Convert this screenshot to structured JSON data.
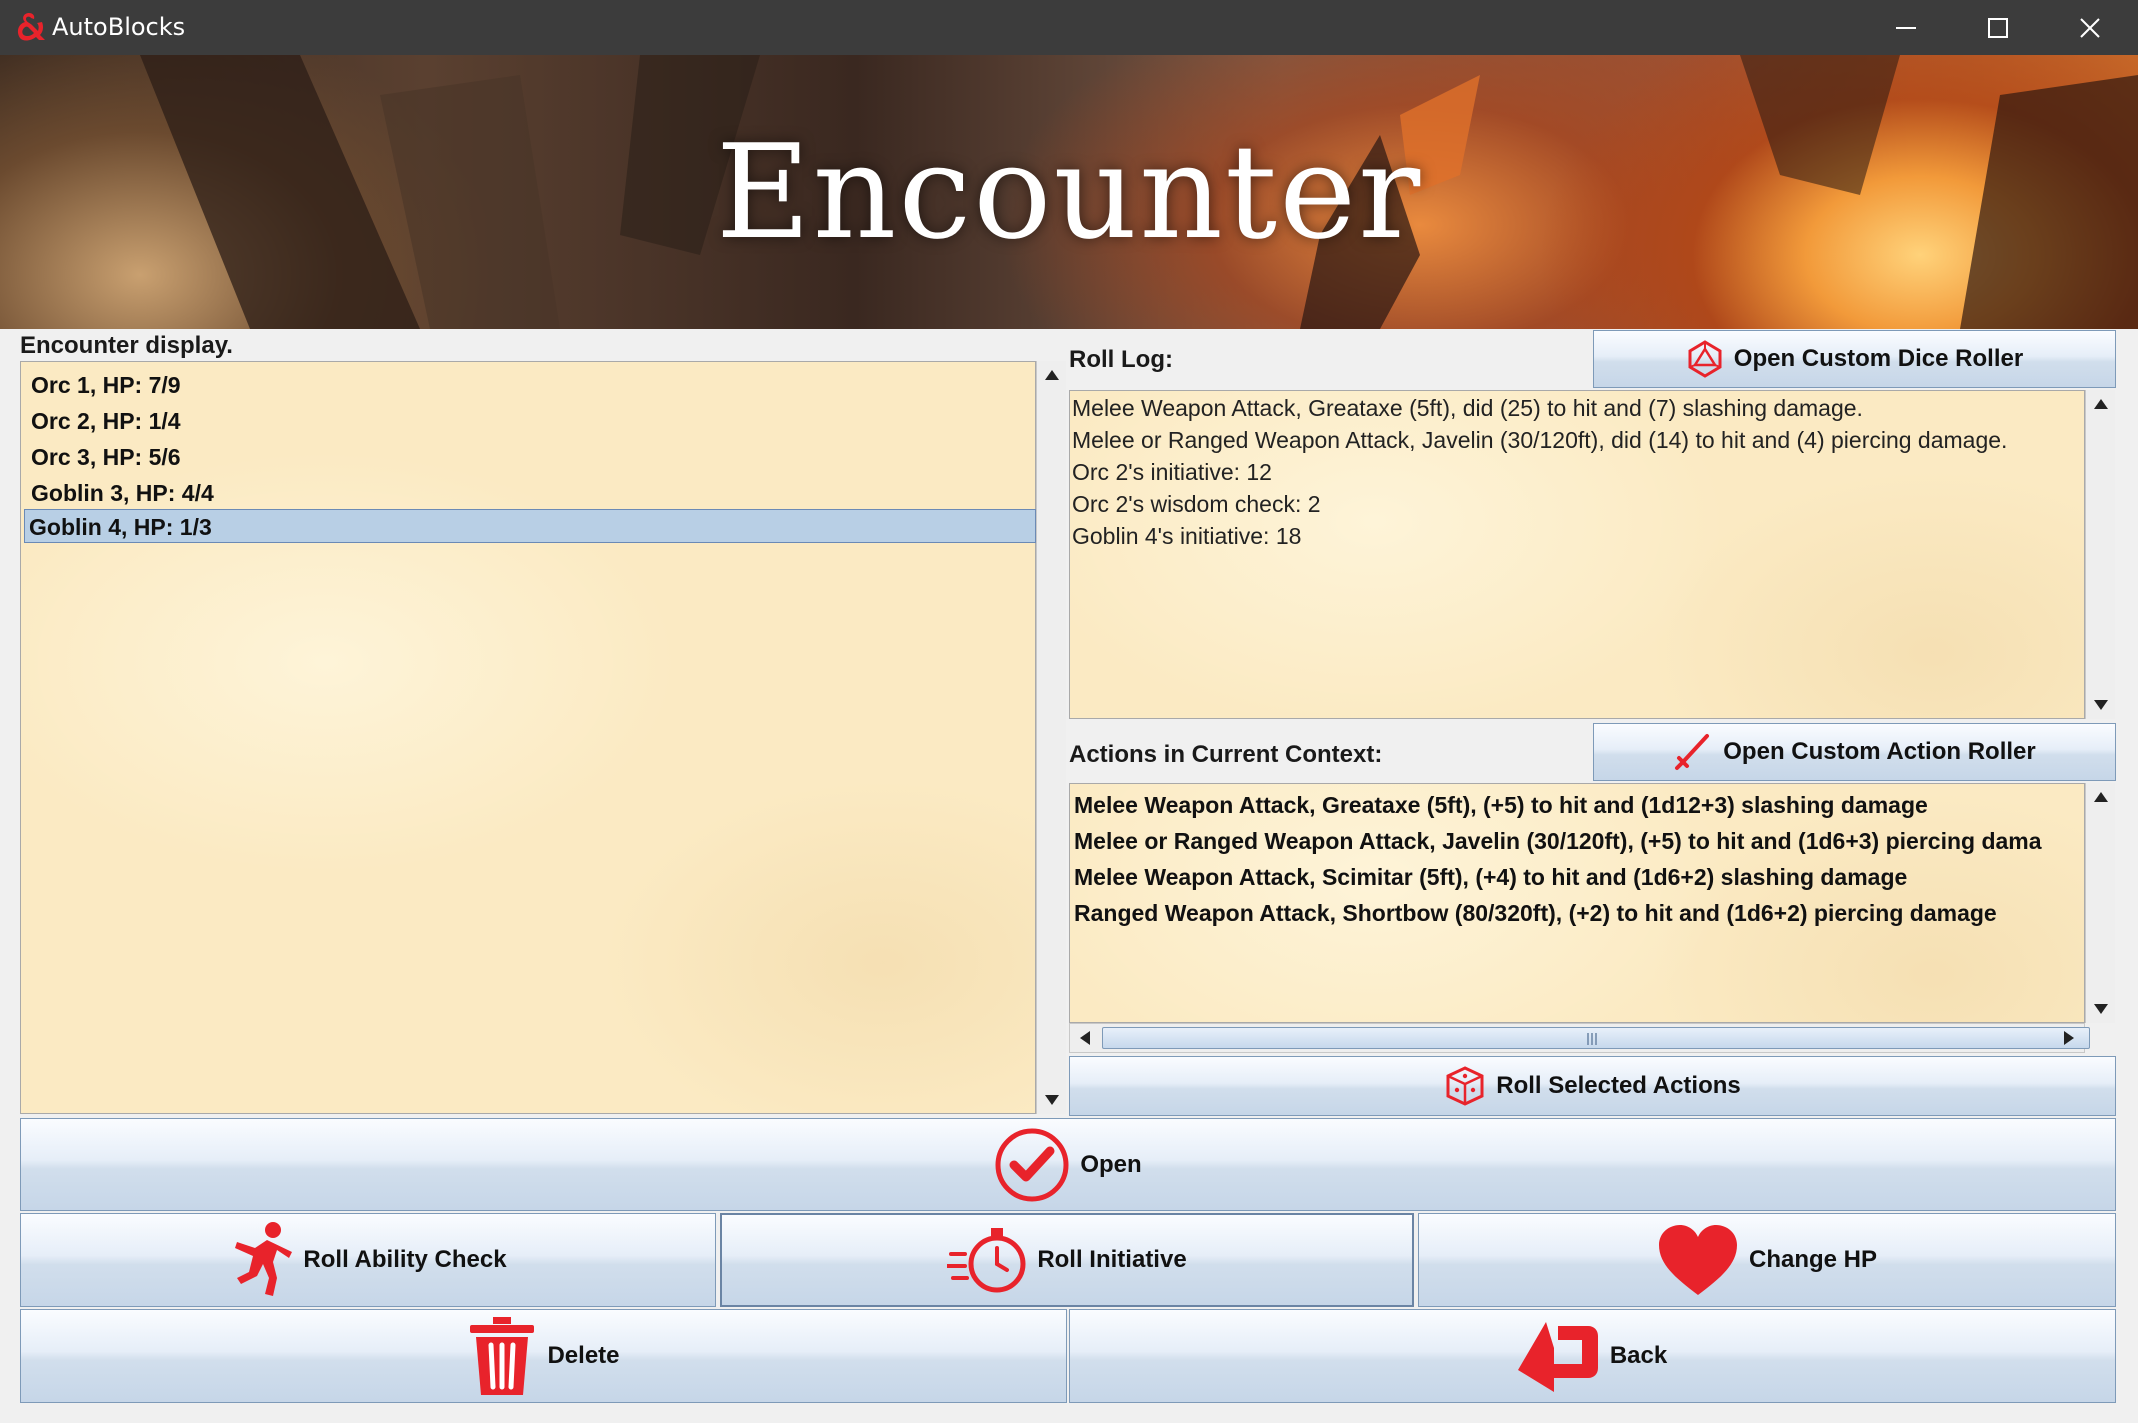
{
  "window": {
    "title": "AutoBlocks",
    "icons": {
      "app": "dragon-ampersand-icon",
      "minimize": "minimize-icon",
      "maximize": "maximize-icon",
      "close": "close-icon"
    }
  },
  "banner": {
    "title": "Encounter"
  },
  "encounter": {
    "label": "Encounter display.",
    "items": [
      {
        "label": "Orc 1, HP: 7/9"
      },
      {
        "label": "Orc 2, HP: 1/4"
      },
      {
        "label": "Orc 3, HP: 5/6"
      },
      {
        "label": "Goblin 3, HP: 4/4"
      },
      {
        "label": "Goblin 4, HP: 1/3",
        "selected": true
      }
    ]
  },
  "roll_log": {
    "label": "Roll Log:",
    "open_dice_roller_label": "Open Custom Dice Roller",
    "lines": [
      "Melee Weapon Attack, Greataxe (5ft), did (25) to hit and (7) slashing damage.",
      "Melee or Ranged Weapon Attack, Javelin (30/120ft), did (14) to hit and (4) piercing damage.",
      "Orc 2's initiative: 12",
      "Orc 2's wisdom check: 2",
      "Goblin 4's initiative: 18"
    ]
  },
  "actions": {
    "label": "Actions in Current Context:",
    "open_action_roller_label": "Open Custom Action Roller",
    "items": [
      "Melee Weapon Attack, Greataxe (5ft), (+5) to hit and (1d12+3) slashing damage",
      "Melee or Ranged Weapon Attack, Javelin (30/120ft), (+5) to hit and (1d6+3) piercing dama",
      "Melee Weapon Attack, Scimitar (5ft), (+4) to hit and (1d6+2) slashing damage",
      "Ranged Weapon Attack, Shortbow (80/320ft), (+2) to hit and (1d6+2) piercing damage"
    ],
    "roll_selected_label": "Roll Selected Actions"
  },
  "buttons": {
    "open": "Open",
    "roll_ability_check": "Roll Ability Check",
    "roll_initiative": "Roll Initiative",
    "change_hp": "Change HP",
    "delete": "Delete",
    "back": "Back"
  },
  "colors": {
    "accent": "#e8232b",
    "parchment": "#fbeac3",
    "selection": "#b8cfe5",
    "titlebar": "#3c3c3c"
  }
}
